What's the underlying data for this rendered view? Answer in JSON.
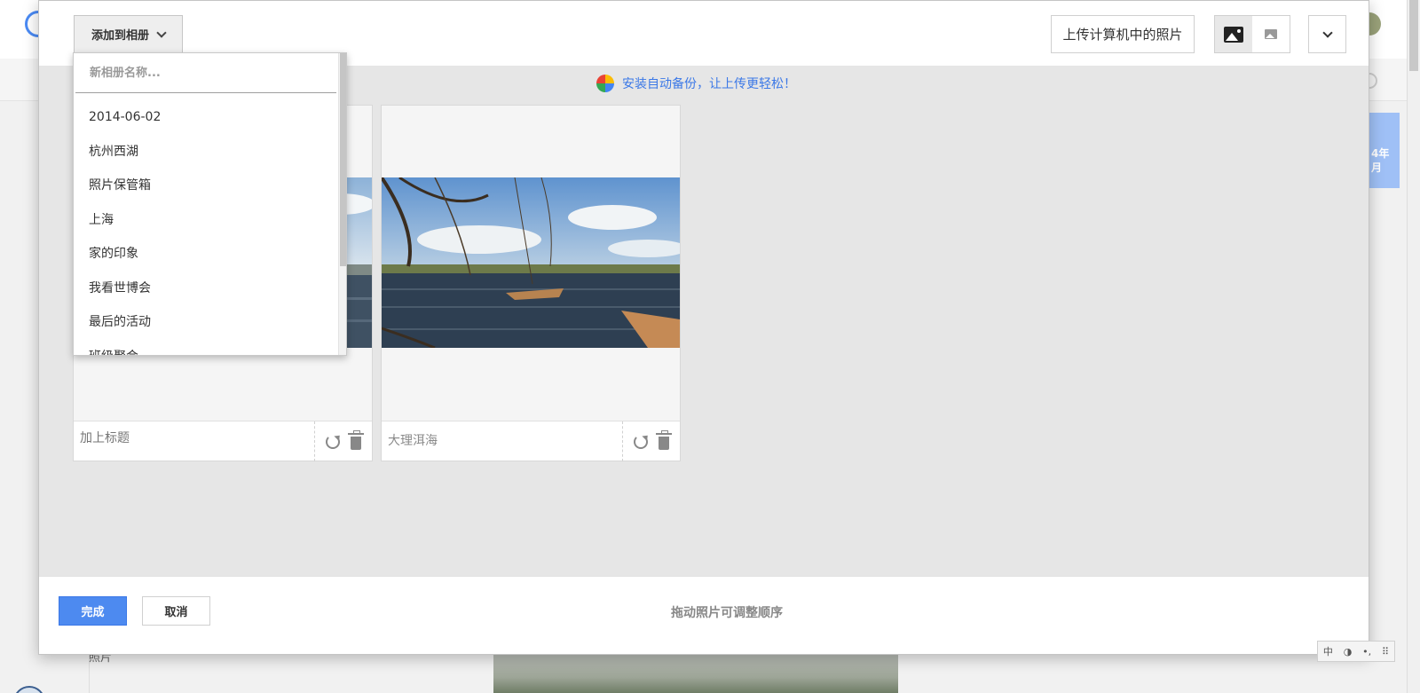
{
  "dialog": {
    "add_to_album_label": "添加到相册",
    "upload_label": "上传计算机中的照片",
    "promo_text": "安装自动备份，让上传更轻松！",
    "photos": [
      {
        "caption": "",
        "caption_placeholder": "加上标题"
      },
      {
        "caption": "大理洱海",
        "caption_placeholder": "加上标题"
      }
    ],
    "done_label": "完成",
    "cancel_label": "取消",
    "hint_text": "拖动照片可调整顺序",
    "icons": {
      "album_chevron": "chevron-down-icon",
      "view_large": "image-large-icon",
      "view_small": "image-small-icon",
      "more": "chevron-down-icon",
      "promo": "google-photos-pinwheel-icon",
      "rotate": "rotate-icon",
      "delete": "trash-icon"
    },
    "colors": {
      "primary_button": "#4d8af0",
      "promo_link": "#3b78e7"
    }
  },
  "album_dropdown": {
    "new_album_placeholder": "新相册名称...",
    "albums": [
      "2014-06-02",
      "杭州西湖",
      "照片保管箱",
      "上海",
      "家的印象",
      "我看世博会",
      "最后的活动",
      "班级聚会"
    ]
  },
  "background": {
    "side_card_text": "4年\n月",
    "bottom_label": "照片"
  },
  "ime_toolbar": {
    "mode": "中",
    "items": [
      "中",
      "◑",
      "•,",
      "⠿"
    ]
  }
}
